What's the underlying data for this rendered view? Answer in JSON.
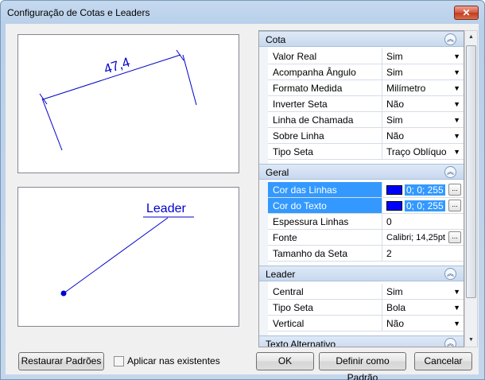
{
  "window": {
    "title": "Configuração de Cotas e Leaders",
    "close_glyph": "✕"
  },
  "preview_top": {
    "dimension_text": "47,4",
    "line_color": "#0000cc"
  },
  "preview_bottom": {
    "leader_text": "Leader",
    "line_color": "#0000cc"
  },
  "grid": {
    "categories": [
      {
        "label": "Cota",
        "toggle": "︽"
      },
      {
        "label": "Geral",
        "toggle": "︽"
      },
      {
        "label": "Leader",
        "toggle": "︽"
      },
      {
        "label": "Texto Alternativo",
        "toggle": "︽"
      }
    ],
    "cota": [
      {
        "label": "Valor Real",
        "value": "Sim"
      },
      {
        "label": "Acompanha Ângulo",
        "value": "Sim"
      },
      {
        "label": "Formato Medida",
        "value": "Milímetro"
      },
      {
        "label": "Inverter Seta",
        "value": "Não"
      },
      {
        "label": "Linha de Chamada",
        "value": "Sim"
      },
      {
        "label": "Sobre Linha",
        "value": "Não"
      },
      {
        "label": "Tipo Seta",
        "value": "Traço Oblíquo"
      }
    ],
    "geral": [
      {
        "label": "Cor das Linhas",
        "value": "0; 0; 255"
      },
      {
        "label": "Cor do Texto",
        "value": "0; 0; 255"
      },
      {
        "label": "Espessura Linhas",
        "value": "0"
      },
      {
        "label": "Fonte",
        "value": "Calibri; 14,25pt"
      },
      {
        "label": "Tamanho da Seta",
        "value": "2"
      }
    ],
    "leader": [
      {
        "label": "Central",
        "value": "Sim"
      },
      {
        "label": "Tipo Seta",
        "value": "Bola"
      },
      {
        "label": "Vertical",
        "value": "Não"
      }
    ],
    "dropdown_glyph": "▼",
    "ellipsis_glyph": "...",
    "swatch_color": "#0000ff"
  },
  "footer": {
    "restore_label": "Restaurar Padrões",
    "apply_label": "Aplicar nas existentes",
    "ok_label": "OK",
    "set_default_label": "Definir como Padrão",
    "cancel_label": "Cancelar"
  },
  "scroll": {
    "up_glyph": "▲",
    "down_glyph": "▼"
  }
}
